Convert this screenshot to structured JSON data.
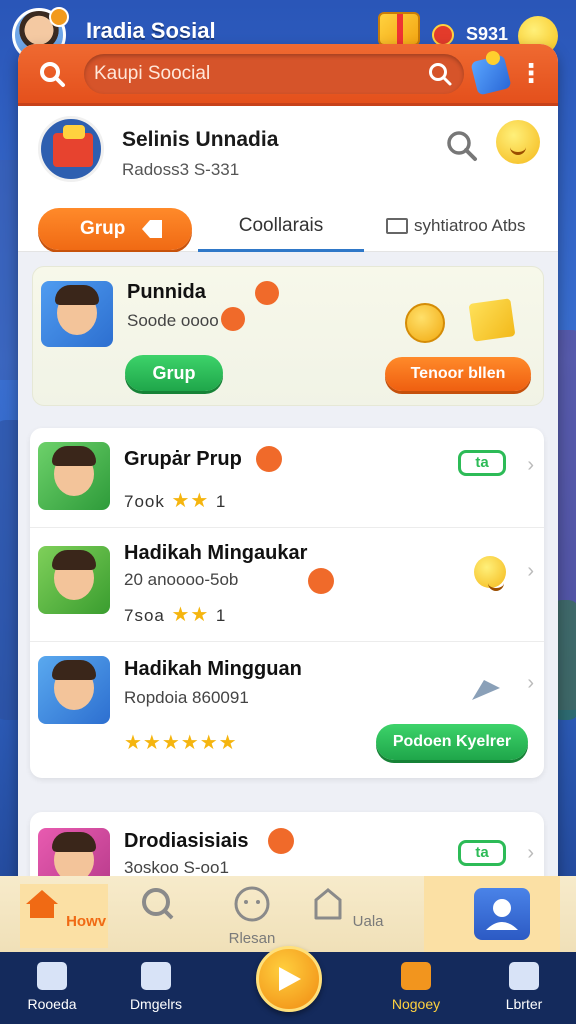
{
  "top": {
    "app_name": "Iradia Sosial",
    "coin_count": "S931"
  },
  "header": {
    "search_placeholder": "Kaupi Soocial"
  },
  "profile": {
    "name": "Selinis Unnadia",
    "subtitle": "Radoss3 S-331"
  },
  "tabs": {
    "active": "Grup",
    "middle": "Coollarais",
    "right": "syhtiatroo Atbs"
  },
  "featured": {
    "name": "Punnida",
    "subtitle": "Soode oooo",
    "primary_button": "Grup",
    "secondary_button": "Tenoor bllen"
  },
  "groups": [
    {
      "title": "Grupȧr Prup",
      "meta": "7ook",
      "stars": "★★",
      "rating_label": "1",
      "tag": "ta"
    },
    {
      "title": "Hadikah Mingaukar",
      "subtitle": "20 anoooo-5ob",
      "meta": "7soa",
      "stars": "★★",
      "rating_label": "1"
    },
    {
      "title": "Hadikah Mingguan",
      "subtitle": "Ropdoia 860091",
      "stars": "★★★★★★",
      "button": "Podoen Kyelrer"
    }
  ],
  "extra_card": {
    "title": "Drodiasisiais",
    "subtitle": "3oskoo S-oo1",
    "tag": "ta"
  },
  "subnav": {
    "items": [
      {
        "label": "Howv",
        "icon": "home-icon"
      },
      {
        "label": "",
        "icon": "search-icon"
      },
      {
        "label": "Rlesan",
        "icon": "chat-icon"
      },
      {
        "label": "Uala",
        "icon": "shop-icon"
      }
    ]
  },
  "bottom_nav": {
    "items": [
      {
        "label": "Rooeda",
        "icon": "home-icon"
      },
      {
        "label": "Dmgelrs",
        "icon": "group-icon"
      },
      {
        "label": "Nogoey",
        "icon": "wallet-icon"
      },
      {
        "label": "Lbrter",
        "icon": "profile-icon"
      }
    ]
  },
  "colors": {
    "accent_orange": "#f06a14",
    "accent_green": "#1fa64a",
    "nav_bg": "#142a5c",
    "page_bg": "#2f62c2"
  }
}
